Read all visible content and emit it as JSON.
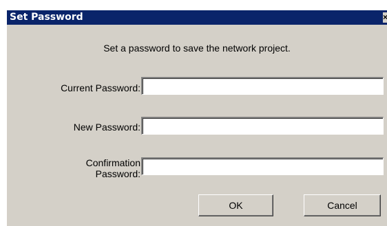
{
  "dialog": {
    "title": "Set Password",
    "close_glyph": "×",
    "instruction": "Set a password to save the network project.",
    "fields": {
      "current_label": "Current Password:",
      "new_label": "New Password:",
      "confirm_label_line1": "Confirmation",
      "confirm_label_line2": "Password:",
      "current_value": "",
      "new_value": "",
      "confirm_value": ""
    },
    "buttons": {
      "ok_label": "OK",
      "cancel_label": "Cancel"
    }
  },
  "colors": {
    "titlebar": "#0a246a",
    "dialog_face": "#d4d0c8",
    "field_background": "#ffffff"
  },
  "icons": {
    "close": "close-icon"
  }
}
